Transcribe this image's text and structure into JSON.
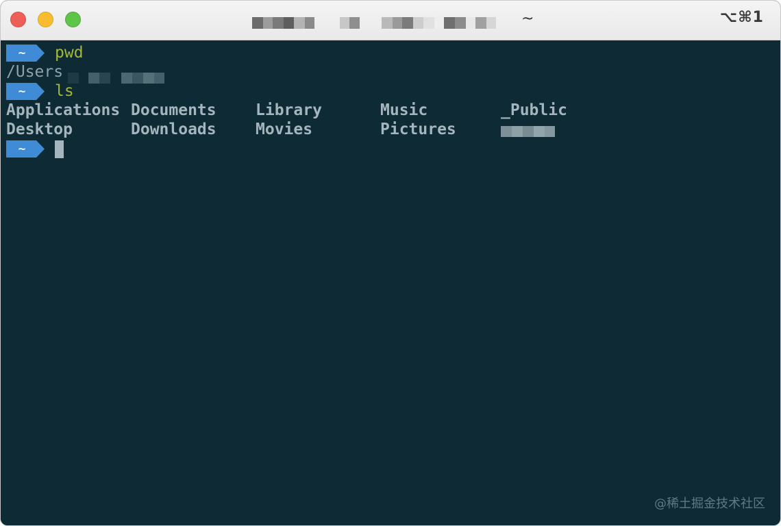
{
  "window": {
    "shortcut": "⌥⌘1",
    "title_tail": "~"
  },
  "prompt": {
    "symbol": "~",
    "color": "#3f8bd6"
  },
  "session": {
    "cmd1": "pwd",
    "out1": "/Users",
    "cmd2": "ls",
    "ls_rows": [
      [
        "Applications",
        "Documents",
        "Library",
        "Music",
        "_Public"
      ],
      [
        "Desktop",
        "Downloads",
        "Movies",
        "Pictures",
        ""
      ]
    ]
  },
  "watermark": "@稀土掘金技术社区",
  "colors": {
    "terminal_bg": "#0d2a35",
    "command": "#a3b73a",
    "listing": "#a4b5bd"
  }
}
